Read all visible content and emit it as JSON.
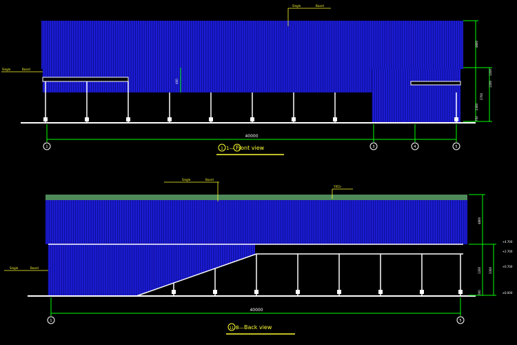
{
  "front": {
    "callout_top_a": "Single",
    "callout_top_b": "Board",
    "callout_left_a": "Single",
    "callout_left_b": "Board",
    "dims_right": [
      "4800",
      "1200",
      "1200",
      "3700",
      "2300",
      "700"
    ],
    "dim_overall": "40000",
    "dim_mid": "400",
    "axis_labels": [
      "1",
      "3",
      "4",
      "5"
    ],
    "title_prefix": "1—",
    "title_text": "Front view"
  },
  "back": {
    "callout_top_a": "Single",
    "callout_top_b": "Board",
    "callout_ridge": "YX51-",
    "callout_left_a": "Single",
    "callout_left_b": "Board",
    "dims_right": [
      "4800",
      "3300",
      "1200",
      "300"
    ],
    "levels": [
      "+4.700",
      "+2.700",
      "+0.700",
      "±0.000"
    ],
    "dim_overall": "40000",
    "axis_labels": [
      "1",
      "5"
    ],
    "title_prefix": "B—",
    "title_text": "Back view"
  },
  "colors": {
    "cladding": "#1c1cd6",
    "rib": "#0a0a7a",
    "line": "#ffffff",
    "dim": "#00ff00",
    "text": "#ffff33",
    "ridge": "#4f8a5a"
  }
}
